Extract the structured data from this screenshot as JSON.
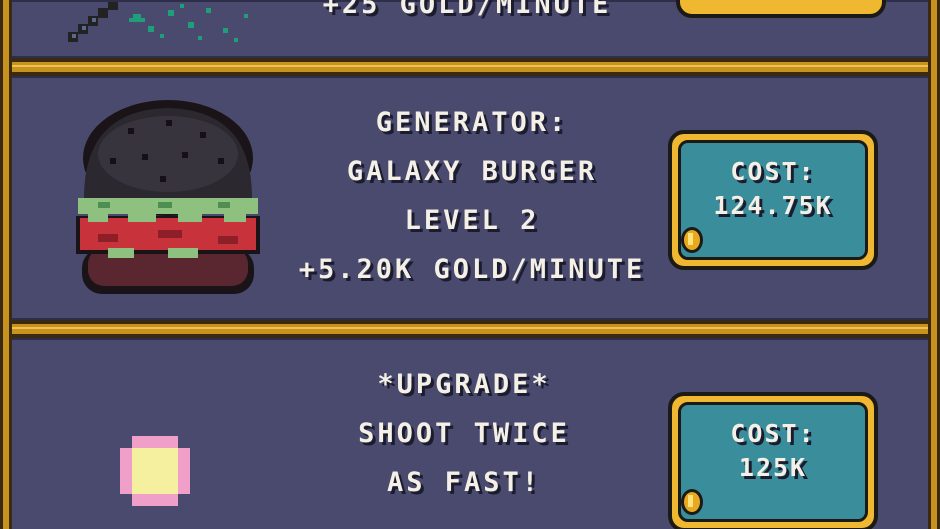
{
  "top_item": {
    "line_partial": "+25 GOLD/MINUTE"
  },
  "generator_item": {
    "icon": "galaxy-burger",
    "lines": [
      "GENERATOR:",
      "GALAXY BURGER",
      "LEVEL 2",
      "+5.20K GOLD/MINUTE"
    ],
    "cost_label": "COST:",
    "cost_value": "124.75K",
    "currency_icon": "gold-coin"
  },
  "upgrade_item": {
    "icon": "glowing-shot",
    "lines": [
      "*UPGRADE*",
      "SHOOT TWICE",
      "AS FAST!"
    ],
    "cost_label": "COST:",
    "cost_value": "125K",
    "currency_icon": "gold-coin"
  },
  "colors": {
    "panel": "#4a4a6e",
    "frame_gold": "#c8921e",
    "button_teal": "#3a8e9c",
    "button_rim": "#f0b830",
    "text": "#f4f0e6"
  }
}
